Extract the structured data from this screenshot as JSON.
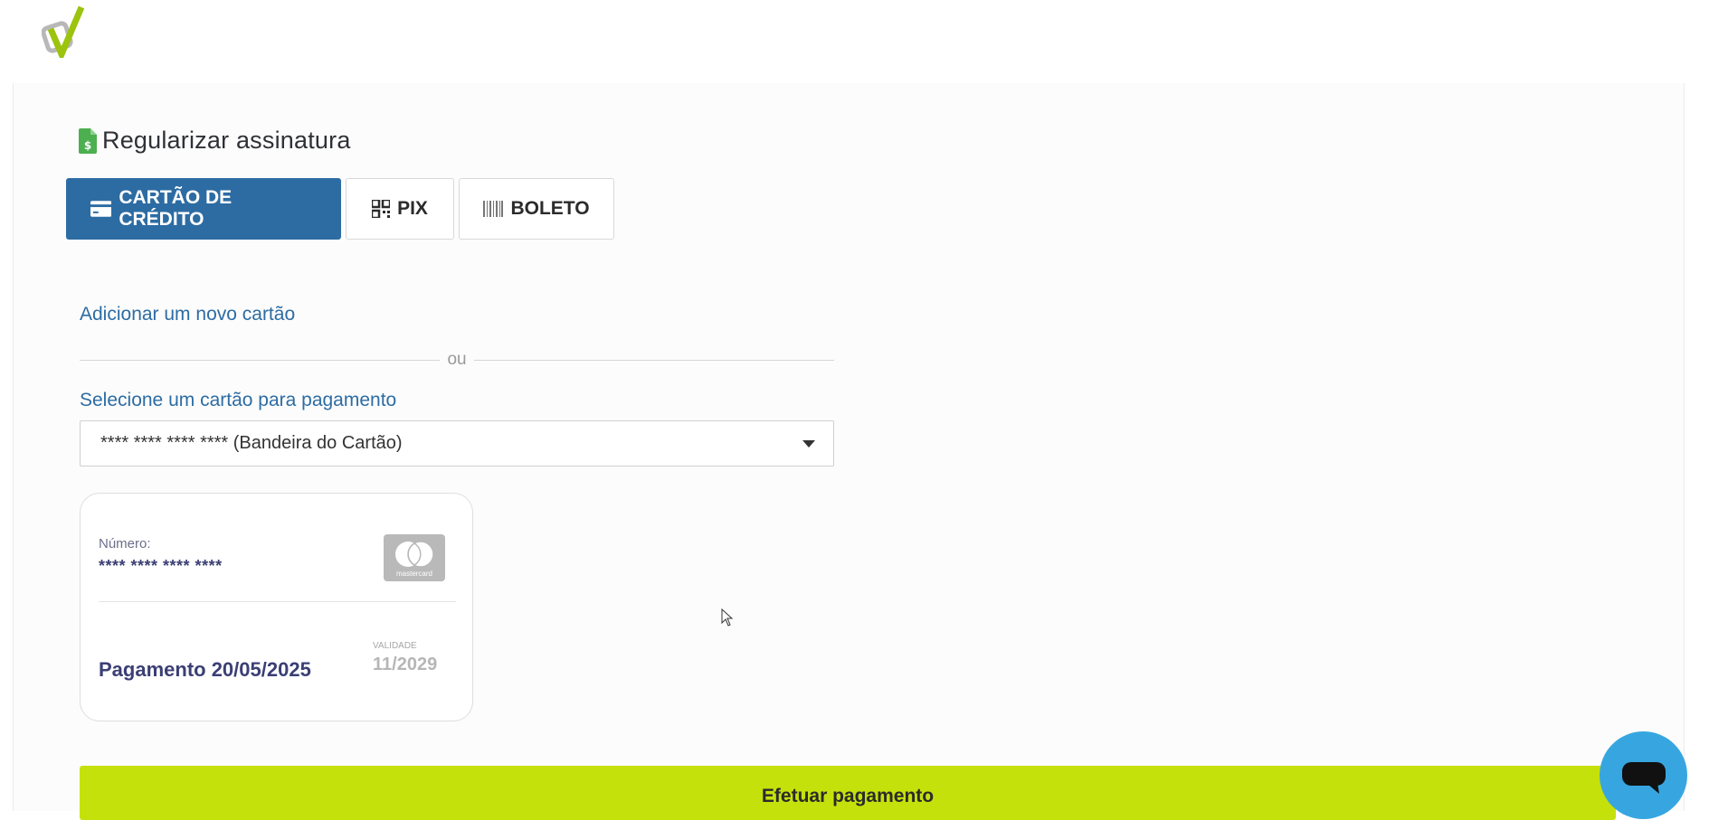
{
  "header": {
    "logo_icon": "checkmark-logo-icon"
  },
  "page": {
    "title": "Regularizar assinatura",
    "title_icon": "invoice-dollar-icon",
    "title_icon_color": "#4caf50"
  },
  "tabs": [
    {
      "label": "CARTÃO DE CRÉDITO",
      "icon": "credit-card-icon",
      "active": true
    },
    {
      "label": "PIX",
      "icon": "qrcode-icon",
      "active": false
    },
    {
      "label": "BOLETO",
      "icon": "barcode-icon",
      "active": false
    }
  ],
  "add_card_link": "Adicionar um novo cartão",
  "divider_text": "ou",
  "card_select": {
    "label": "Selecione um cartão para pagamento",
    "selected": "**** **** **** **** (Bandeira do Cartão)"
  },
  "card": {
    "number_label": "Número:",
    "number_value": "**** **** **** ****",
    "brand_icon": "mastercard-icon",
    "brand_text": "mastercard",
    "payment": "Pagamento 20/05/2025",
    "validity_label": "VALIDADE",
    "validity_value": "11/2029"
  },
  "pay_button": "Efetuar pagamento",
  "chat_button_icon": "chat-bubble-icon",
  "colors": {
    "primary": "#2d6ca3",
    "accent": "#c5e10b",
    "card_text": "#3b3f74",
    "chat": "#37a6e0"
  }
}
